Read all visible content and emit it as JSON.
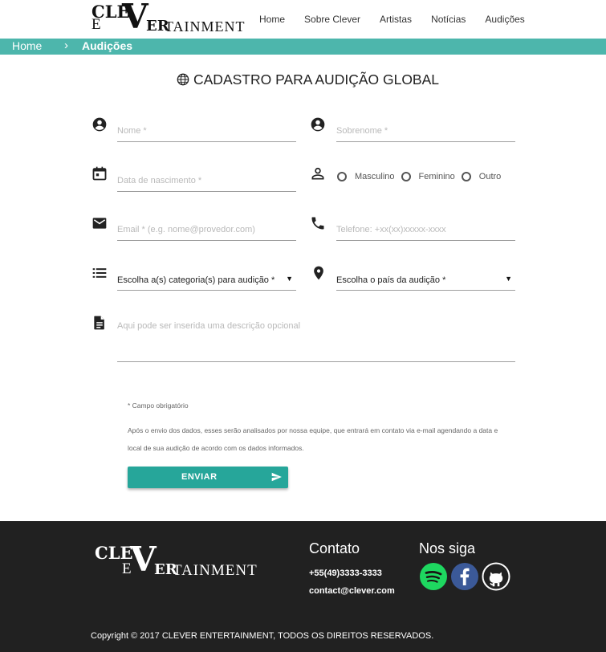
{
  "brand": {
    "logo_clev": "CLE",
    "logo_e": "E",
    "logo_v": "V",
    "logo_er": "ER",
    "logo_tainment": "TAINMENT"
  },
  "nav": {
    "items": [
      "Home",
      "Sobre Clever",
      "Artistas",
      "Notícias",
      "Audições"
    ]
  },
  "breadcrumb": {
    "home": "Home",
    "separator": "›",
    "current": "Audições",
    "bar_color": "#4db6ac"
  },
  "page": {
    "title": "CADASTRO PARA AUDIÇÃO GLOBAL",
    "title_icon": "globe-icon"
  },
  "form": {
    "nome_placeholder": "Nome *",
    "sobrenome_placeholder": "Sobrenome *",
    "nascimento_placeholder": "Data de nascimento *",
    "gender_options": [
      "Masculino",
      "Feminino",
      "Outro"
    ],
    "email_placeholder": "Email * (e.g. nome@provedor.com)",
    "telefone_placeholder": "Telefone: +xx(xx)xxxxx-xxxx",
    "categoria_selected": "Escolha a(s) categoria(s) para audição *",
    "pais_selected": "Escolha o país da audição *",
    "descricao_placeholder": "Aqui pode ser inserida uma descrição opcional",
    "required_note": "* Campo obrigatório",
    "info_line1": "Após o envio dos dados, esses serão analisados por nossa equipe, que entrará em contato via e-mail agendando a data e",
    "info_line2": "local de sua audição de acordo com os dados informados.",
    "submit_label": "ENVIAR",
    "button_color": "#26a69a",
    "icons": [
      "account-circle-icon",
      "account-circle-icon",
      "calendar-icon",
      "person-outline-icon",
      "email-icon",
      "phone-icon",
      "list-icon",
      "location-pin-icon",
      "description-icon",
      "send-icon"
    ]
  },
  "footer": {
    "contact_heading": "Contato",
    "phone": "+55(49)3333-3333",
    "email": "contact@clever.com",
    "follow_heading": "Nos siga",
    "social_icons": [
      "spotify-icon",
      "facebook-icon",
      "github-icon"
    ],
    "copyright": "Copyright © 2017 CLEVER ENTERTAINMENT, TODOS OS DIREITOS RESERVADOS.",
    "background": "#212121"
  }
}
